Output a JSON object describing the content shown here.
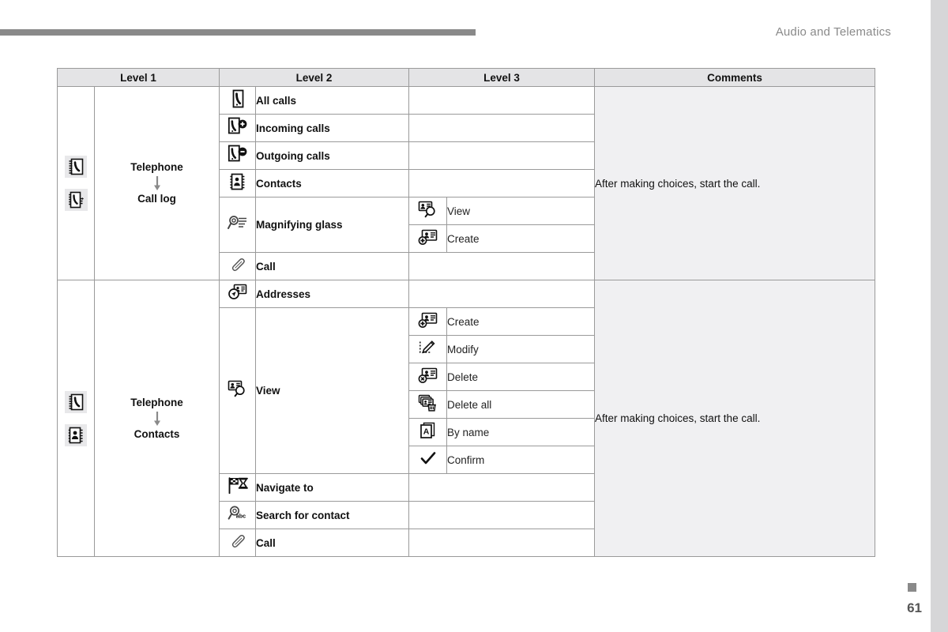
{
  "header": {
    "title": "Audio and Telematics"
  },
  "footer": {
    "page_number": "61"
  },
  "table": {
    "columns": [
      {
        "key": "level1",
        "label": "Level 1"
      },
      {
        "key": "level2",
        "label": "Level 2"
      },
      {
        "key": "level3",
        "label": "Level 3"
      },
      {
        "key": "comments",
        "label": "Comments"
      }
    ],
    "sections": [
      {
        "level1": {
          "icons": [
            "phonebook-icon",
            "call-log-icon"
          ],
          "line1": "Telephone",
          "arrow": "down-arrow-icon",
          "line2": "Call log"
        },
        "comment": "After making choices, start the call.",
        "rows": [
          {
            "l2_icon": "all-calls-icon",
            "l2_label": "All calls",
            "level3": []
          },
          {
            "l2_icon": "incoming-calls-icon",
            "l2_label": "Incoming calls",
            "level3": []
          },
          {
            "l2_icon": "outgoing-calls-icon",
            "l2_label": "Outgoing calls",
            "level3": []
          },
          {
            "l2_icon": "contacts-icon",
            "l2_label": "Contacts",
            "level3": []
          },
          {
            "l2_icon": "magnifying-glass-icon",
            "l2_label": "Magnifying glass",
            "level3": [
              {
                "icon": "view-contact-icon",
                "label": "View"
              },
              {
                "icon": "create-contact-icon",
                "label": "Create"
              }
            ]
          },
          {
            "l2_icon": "call-handset-icon",
            "l2_label": "Call",
            "level3": []
          }
        ]
      },
      {
        "level1": {
          "icons": [
            "phonebook-icon",
            "contacts-book-icon"
          ],
          "line1": "Telephone",
          "arrow": "down-arrow-icon",
          "line2": "Contacts"
        },
        "comment": "After making choices, start the call.",
        "rows": [
          {
            "l2_icon": "addresses-icon",
            "l2_label": "Addresses",
            "level3": []
          },
          {
            "l2_icon": "view-contact-icon",
            "l2_label": "View",
            "level3": [
              {
                "icon": "create-contact-icon",
                "label": "Create"
              },
              {
                "icon": "modify-contact-icon",
                "label": "Modify"
              },
              {
                "icon": "delete-contact-icon",
                "label": "Delete"
              },
              {
                "icon": "delete-all-icon",
                "label": "Delete all"
              },
              {
                "icon": "by-name-icon",
                "label": "By name"
              },
              {
                "icon": "confirm-check-icon",
                "label": "Confirm"
              }
            ]
          },
          {
            "l2_icon": "navigate-to-icon",
            "l2_label": "Navigate to",
            "level3": []
          },
          {
            "l2_icon": "search-contact-icon",
            "l2_label": "Search for contact",
            "level3": []
          },
          {
            "l2_icon": "call-handset-icon",
            "l2_label": "Call",
            "level3": []
          }
        ]
      }
    ]
  }
}
